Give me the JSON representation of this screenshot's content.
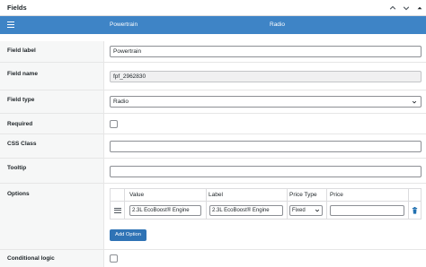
{
  "panel": {
    "title": "Fields"
  },
  "bar": {
    "col1": "Powertrain",
    "col2": "Radio"
  },
  "fields": {
    "label": {
      "label": "Field label",
      "value": "Powertrain"
    },
    "name": {
      "label": "Field name",
      "value": "fpf_2962830"
    },
    "type": {
      "label": "Field type",
      "value": "Radio"
    },
    "required": {
      "label": "Required"
    },
    "css": {
      "label": "CSS Class",
      "value": ""
    },
    "tooltip": {
      "label": "Tooltip",
      "value": ""
    },
    "options": {
      "label": "Options",
      "headers": {
        "value": "Value",
        "label": "Label",
        "price_type": "Price Type",
        "price": "Price"
      },
      "rows": [
        {
          "value": "2.3L EcoBoost® Engine",
          "label": "2.3L EcoBoost® Engine",
          "price_type": "Fixed",
          "price": ""
        }
      ],
      "add_button": "Add Option"
    },
    "conditional": {
      "label": "Conditional logic"
    }
  },
  "icons": [
    "chevron-up-icon",
    "chevron-down-icon",
    "collapse-arrow-icon",
    "menu-icon",
    "drag-handle-icon",
    "trash-icon",
    "select-arrow-icon"
  ],
  "colors": {
    "accent": "#3e84c6",
    "button": "#2f73b5",
    "trash": "#2271b1"
  }
}
